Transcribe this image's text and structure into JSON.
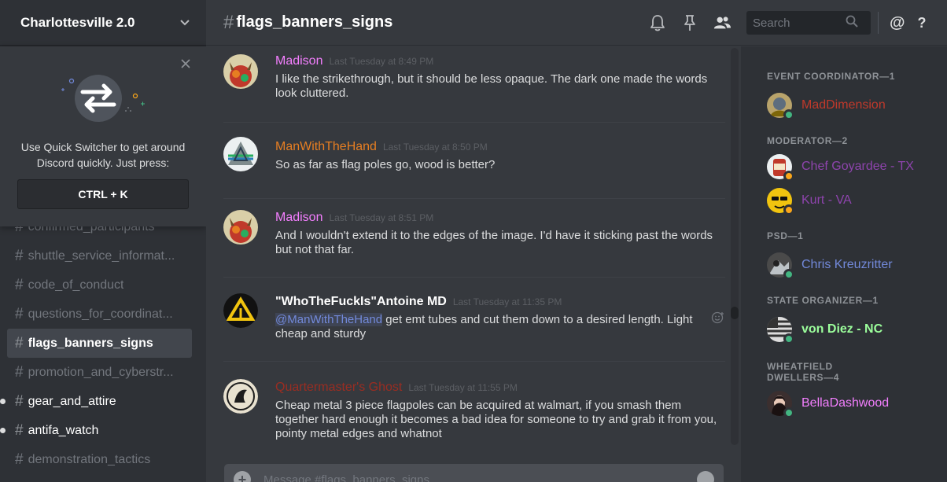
{
  "server": {
    "name": "Charlottesville 2.0"
  },
  "quick_switcher": {
    "text_line1": "Use Quick Switcher to get around",
    "text_line2": "Discord quickly. Just press:",
    "shortcut": "CTRL + K"
  },
  "channels": [
    {
      "name": "confirmed_participants",
      "state": "muted"
    },
    {
      "name": "shuttle_service_informat...",
      "state": "muted"
    },
    {
      "name": "code_of_conduct",
      "state": "muted"
    },
    {
      "name": "questions_for_coordinat...",
      "state": "muted"
    },
    {
      "name": "flags_banners_signs",
      "state": "active"
    },
    {
      "name": "promotion_and_cyberstr...",
      "state": "muted"
    },
    {
      "name": "gear_and_attire",
      "state": "unread"
    },
    {
      "name": "antifa_watch",
      "state": "unread"
    },
    {
      "name": "demonstration_tactics",
      "state": "muted"
    }
  ],
  "header": {
    "channel_name": "flags_banners_signs",
    "search_placeholder": "Search",
    "icons": [
      "bell-icon",
      "pin-icon",
      "members-icon",
      "search-icon",
      "mention-icon",
      "help-icon"
    ]
  },
  "messages": [
    {
      "author": "Madison",
      "color": "#f47fff",
      "timestamp": "Last Tuesday at 8:49 PM",
      "text": "I like the strikethrough, but it should be less opaque. The dark one made the words look cluttered."
    },
    {
      "author": "ManWithTheHand",
      "color": "#e67e22",
      "timestamp": "Last Tuesday at 8:50 PM",
      "text": "So as far as flag poles go, wood is better?"
    },
    {
      "author": "Madison",
      "color": "#f47fff",
      "timestamp": "Last Tuesday at 8:51 PM",
      "text": "And I wouldn't extend it to the edges of the image. I'd have it sticking past the words but not that far."
    },
    {
      "author": "\"WhoTheFuckIs\"Antoine MD",
      "color": "#ffffff",
      "timestamp": "Last Tuesday at 11:35 PM",
      "mention": "@ManWithTheHand",
      "text": " get emt tubes and cut them down to a desired length. Light cheap and sturdy"
    },
    {
      "author": "Quartermaster's Ghost",
      "color": "#992d22",
      "timestamp": "Last Tuesday at 11:55 PM",
      "text": "Cheap metal 3 piece flagpoles can be acquired at walmart, if you smash them together hard enough it becomes a bad idea for someone to try and grab it from you, pointy metal edges and whatnot"
    }
  ],
  "composer": {
    "placeholder": "Message #flags_banners_signs"
  },
  "member_groups": [
    {
      "role": "EVENT COORDINATOR—1",
      "members": [
        {
          "name": "MadDimension",
          "color": "#c0392b",
          "status": "online"
        }
      ]
    },
    {
      "role": "MODERATOR—2",
      "members": [
        {
          "name": "Chef Goyardee - TX",
          "color": "#8e44ad",
          "status": "idle"
        },
        {
          "name": "Kurt - VA",
          "color": "#8e44ad",
          "status": "idle"
        }
      ]
    },
    {
      "role": "PSD—1",
      "members": [
        {
          "name": "Chris Kreuzritter",
          "color": "#7289da",
          "status": "online"
        }
      ]
    },
    {
      "role": "STATE ORGANIZER—1",
      "members": [
        {
          "name": "von Diez - NC",
          "color": "#9cff9c",
          "status": "online"
        }
      ]
    },
    {
      "role": "WHEATFIELD DWELLERS—4",
      "members": [
        {
          "name": "BellaDashwood",
          "color": "#f47fff",
          "status": "online"
        }
      ]
    }
  ],
  "colors": {
    "online": "#43b581",
    "idle": "#faa61a",
    "accent": "#7289da"
  }
}
